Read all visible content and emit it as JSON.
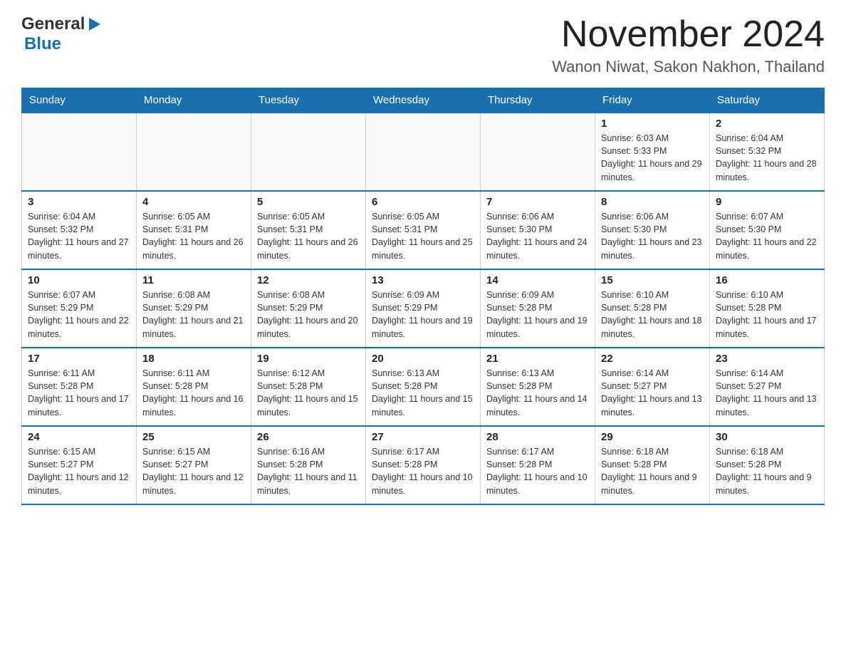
{
  "header": {
    "logo_general": "General",
    "logo_blue": "Blue",
    "month_title": "November 2024",
    "location": "Wanon Niwat, Sakon Nakhon, Thailand"
  },
  "days_of_week": [
    "Sunday",
    "Monday",
    "Tuesday",
    "Wednesday",
    "Thursday",
    "Friday",
    "Saturday"
  ],
  "weeks": [
    [
      {
        "day": "",
        "info": ""
      },
      {
        "day": "",
        "info": ""
      },
      {
        "day": "",
        "info": ""
      },
      {
        "day": "",
        "info": ""
      },
      {
        "day": "",
        "info": ""
      },
      {
        "day": "1",
        "info": "Sunrise: 6:03 AM\nSunset: 5:33 PM\nDaylight: 11 hours and 29 minutes."
      },
      {
        "day": "2",
        "info": "Sunrise: 6:04 AM\nSunset: 5:32 PM\nDaylight: 11 hours and 28 minutes."
      }
    ],
    [
      {
        "day": "3",
        "info": "Sunrise: 6:04 AM\nSunset: 5:32 PM\nDaylight: 11 hours and 27 minutes."
      },
      {
        "day": "4",
        "info": "Sunrise: 6:05 AM\nSunset: 5:31 PM\nDaylight: 11 hours and 26 minutes."
      },
      {
        "day": "5",
        "info": "Sunrise: 6:05 AM\nSunset: 5:31 PM\nDaylight: 11 hours and 26 minutes."
      },
      {
        "day": "6",
        "info": "Sunrise: 6:05 AM\nSunset: 5:31 PM\nDaylight: 11 hours and 25 minutes."
      },
      {
        "day": "7",
        "info": "Sunrise: 6:06 AM\nSunset: 5:30 PM\nDaylight: 11 hours and 24 minutes."
      },
      {
        "day": "8",
        "info": "Sunrise: 6:06 AM\nSunset: 5:30 PM\nDaylight: 11 hours and 23 minutes."
      },
      {
        "day": "9",
        "info": "Sunrise: 6:07 AM\nSunset: 5:30 PM\nDaylight: 11 hours and 22 minutes."
      }
    ],
    [
      {
        "day": "10",
        "info": "Sunrise: 6:07 AM\nSunset: 5:29 PM\nDaylight: 11 hours and 22 minutes."
      },
      {
        "day": "11",
        "info": "Sunrise: 6:08 AM\nSunset: 5:29 PM\nDaylight: 11 hours and 21 minutes."
      },
      {
        "day": "12",
        "info": "Sunrise: 6:08 AM\nSunset: 5:29 PM\nDaylight: 11 hours and 20 minutes."
      },
      {
        "day": "13",
        "info": "Sunrise: 6:09 AM\nSunset: 5:29 PM\nDaylight: 11 hours and 19 minutes."
      },
      {
        "day": "14",
        "info": "Sunrise: 6:09 AM\nSunset: 5:28 PM\nDaylight: 11 hours and 19 minutes."
      },
      {
        "day": "15",
        "info": "Sunrise: 6:10 AM\nSunset: 5:28 PM\nDaylight: 11 hours and 18 minutes."
      },
      {
        "day": "16",
        "info": "Sunrise: 6:10 AM\nSunset: 5:28 PM\nDaylight: 11 hours and 17 minutes."
      }
    ],
    [
      {
        "day": "17",
        "info": "Sunrise: 6:11 AM\nSunset: 5:28 PM\nDaylight: 11 hours and 17 minutes."
      },
      {
        "day": "18",
        "info": "Sunrise: 6:11 AM\nSunset: 5:28 PM\nDaylight: 11 hours and 16 minutes."
      },
      {
        "day": "19",
        "info": "Sunrise: 6:12 AM\nSunset: 5:28 PM\nDaylight: 11 hours and 15 minutes."
      },
      {
        "day": "20",
        "info": "Sunrise: 6:13 AM\nSunset: 5:28 PM\nDaylight: 11 hours and 15 minutes."
      },
      {
        "day": "21",
        "info": "Sunrise: 6:13 AM\nSunset: 5:28 PM\nDaylight: 11 hours and 14 minutes."
      },
      {
        "day": "22",
        "info": "Sunrise: 6:14 AM\nSunset: 5:27 PM\nDaylight: 11 hours and 13 minutes."
      },
      {
        "day": "23",
        "info": "Sunrise: 6:14 AM\nSunset: 5:27 PM\nDaylight: 11 hours and 13 minutes."
      }
    ],
    [
      {
        "day": "24",
        "info": "Sunrise: 6:15 AM\nSunset: 5:27 PM\nDaylight: 11 hours and 12 minutes."
      },
      {
        "day": "25",
        "info": "Sunrise: 6:15 AM\nSunset: 5:27 PM\nDaylight: 11 hours and 12 minutes."
      },
      {
        "day": "26",
        "info": "Sunrise: 6:16 AM\nSunset: 5:28 PM\nDaylight: 11 hours and 11 minutes."
      },
      {
        "day": "27",
        "info": "Sunrise: 6:17 AM\nSunset: 5:28 PM\nDaylight: 11 hours and 10 minutes."
      },
      {
        "day": "28",
        "info": "Sunrise: 6:17 AM\nSunset: 5:28 PM\nDaylight: 11 hours and 10 minutes."
      },
      {
        "day": "29",
        "info": "Sunrise: 6:18 AM\nSunset: 5:28 PM\nDaylight: 11 hours and 9 minutes."
      },
      {
        "day": "30",
        "info": "Sunrise: 6:18 AM\nSunset: 5:28 PM\nDaylight: 11 hours and 9 minutes."
      }
    ]
  ]
}
